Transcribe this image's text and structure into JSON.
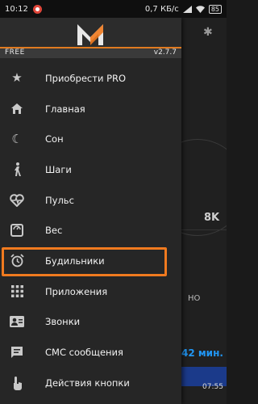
{
  "status_bar": {
    "time": "10:12",
    "network_speed": "0,7 КБ/с",
    "battery": "85"
  },
  "background_app": {
    "steps_value": "8K",
    "partial_text": "НО",
    "duration_text": "42 мин.",
    "time_text": "07:55"
  },
  "drawer": {
    "badge_left": "FREE",
    "version": "v2.7.7",
    "accent_color": "#f07a1f",
    "items": [
      {
        "label": "Приобрести PRO",
        "icon": "star-icon"
      },
      {
        "label": "Главная",
        "icon": "home-icon"
      },
      {
        "label": "Сон",
        "icon": "sleep-icon"
      },
      {
        "label": "Шаги",
        "icon": "walk-icon"
      },
      {
        "label": "Пульс",
        "icon": "heart-pulse-icon"
      },
      {
        "label": "Вес",
        "icon": "scale-icon"
      },
      {
        "label": "Будильники",
        "icon": "alarm-icon"
      },
      {
        "label": "Приложения",
        "icon": "apps-icon"
      },
      {
        "label": "Звонки",
        "icon": "contact-icon"
      },
      {
        "label": "СМС сообщения",
        "icon": "sms-icon"
      },
      {
        "label": "Действия кнопки",
        "icon": "touch-icon"
      }
    ]
  }
}
